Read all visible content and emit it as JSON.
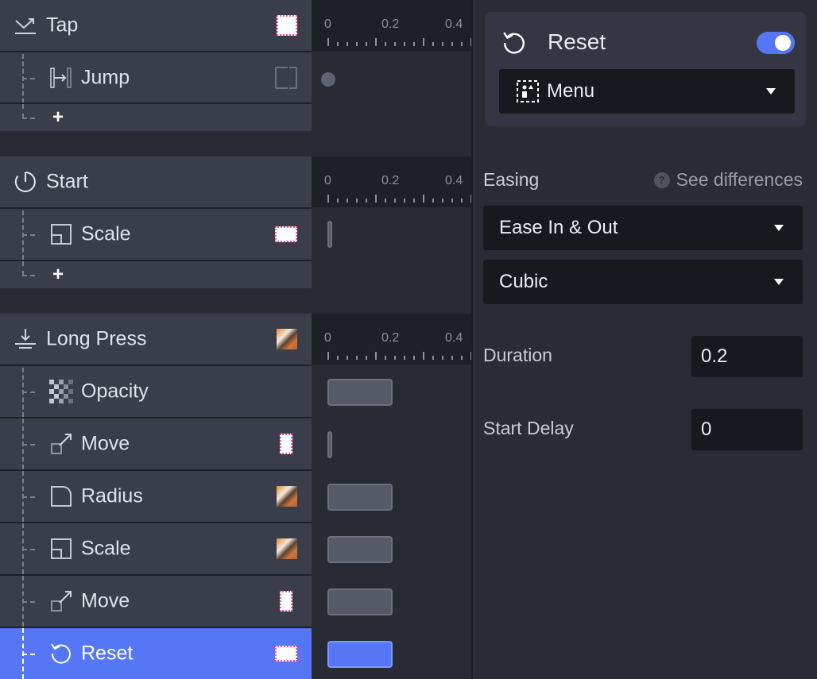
{
  "layers": {
    "groups": [
      {
        "trigger": "Tap",
        "trigger_icon": "tap-icon",
        "thumb": "white-square",
        "children": [
          {
            "label": "Jump",
            "icon": "jump-icon",
            "thumb": "empty-frame"
          }
        ],
        "add_label": "+"
      },
      {
        "trigger": "Start",
        "trigger_icon": "start-icon",
        "thumb": "none",
        "children": [
          {
            "label": "Scale",
            "icon": "scale-icon",
            "thumb": "white-rect"
          }
        ],
        "add_label": "+"
      },
      {
        "trigger": "Long Press",
        "trigger_icon": "long-press-icon",
        "thumb": "photo",
        "children": [
          {
            "label": "Opacity",
            "icon": "opacity-icon",
            "thumb": "none"
          },
          {
            "label": "Move",
            "icon": "move-icon",
            "thumb": "white-tall"
          },
          {
            "label": "Radius",
            "icon": "radius-icon",
            "thumb": "photo"
          },
          {
            "label": "Scale",
            "icon": "scale-icon",
            "thumb": "photo"
          },
          {
            "label": "Move",
            "icon": "move-icon",
            "thumb": "white-tall"
          },
          {
            "label": "Reset",
            "icon": "reset-icon",
            "thumb": "white-rect",
            "selected": true
          }
        ]
      }
    ]
  },
  "timeline": {
    "ruler_labels": [
      "0",
      "0.2",
      "0.4"
    ],
    "tracks": {
      "tap_jump": {
        "type": "dot",
        "start": 0
      },
      "start_scale": {
        "type": "instant",
        "start": 0
      },
      "long_press_opacity": {
        "start": 0,
        "duration": 0.2
      },
      "long_press_move_1": {
        "type": "instant",
        "start": 0
      },
      "long_press_radius": {
        "start": 0,
        "duration": 0.2
      },
      "long_press_scale": {
        "start": 0,
        "duration": 0.2
      },
      "long_press_move_2": {
        "start": 0,
        "duration": 0.2
      },
      "long_press_reset": {
        "start": 0,
        "duration": 0.2,
        "selected": true
      }
    }
  },
  "inspector": {
    "title": "Reset",
    "enabled": true,
    "target": "Menu",
    "easing_label": "Easing",
    "see_differences": "See differences",
    "easing_type": "Ease In & Out",
    "easing_curve": "Cubic",
    "duration_label": "Duration",
    "duration_value": "0.2",
    "start_delay_label": "Start Delay",
    "start_delay_value": "0"
  },
  "colors": {
    "accent": "#5677f5",
    "row_bg": "#3a3e4a",
    "panel_bg": "#292b35",
    "input_bg": "#18191e"
  }
}
